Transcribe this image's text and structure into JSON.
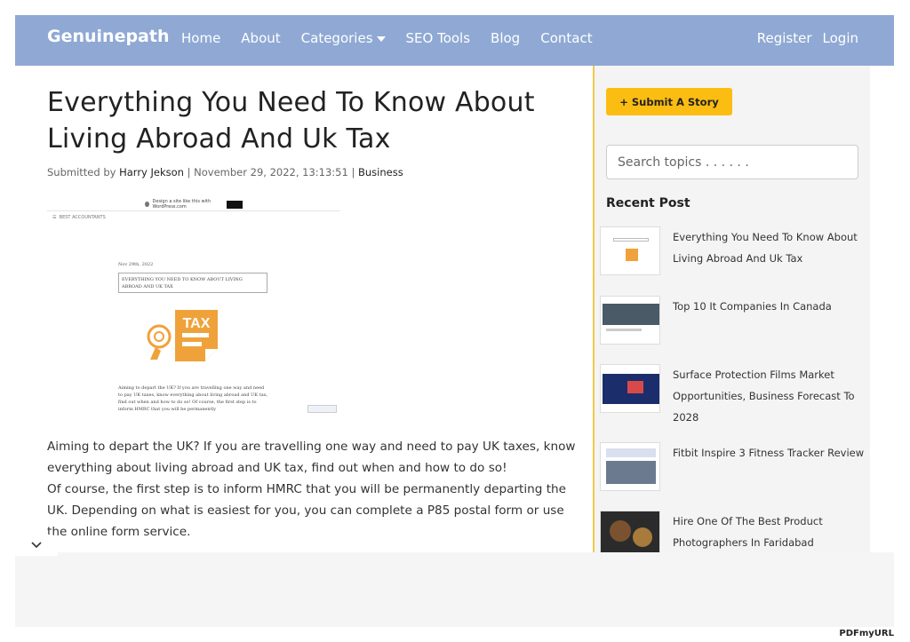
{
  "nav": {
    "brand": "Genuinepath",
    "links": [
      "Home",
      "About",
      "Categories",
      "SEO Tools",
      "Blog",
      "Contact"
    ],
    "register": "Register",
    "login": "Login"
  },
  "article": {
    "title": "Everything You Need To Know About Living Abroad And Uk Tax",
    "submitted_by_prefix": "Submitted by",
    "author": "Harry Jekson",
    "date": "November 29, 2022, 13:13:51",
    "category": "Business",
    "image": {
      "top_bar_text": "Design a site like this with WordPress.com",
      "menu_label": "BEST ACCOUNTANTS",
      "post_date": "Nov 29th, 2022",
      "post_title": "EVERYTHING YOU NEED TO KNOW ABOUT LIVING ABROAD AND UK TAX",
      "icon_label": "TAX",
      "excerpt": "Aiming to depart the UK? If you are travelling one way and need to pay UK taxes, know everything about living abroad and UK tax, find out when and how to do so! Of course, the first step is to inform HMRC that you will be permanently"
    },
    "paragraphs": [
      "Aiming to depart the UK? If you are travelling one way and need to pay UK taxes, know everything about living abroad and UK tax, find out when and how to do so!",
      "Of course, the first step is to inform HMRC that you will be permanently departing the UK. Depending on what is easiest for you, you can complete a P85 postal form or use the online form service."
    ]
  },
  "sidebar": {
    "submit_label": "+ Submit A Story",
    "search_placeholder": "Search topics . . . . . .",
    "recent_title": "Recent Post",
    "recent": [
      "Everything You Need To Know About Living Abroad And Uk Tax",
      "Top 10 It Companies In Canada",
      "Surface Protection Films Market Opportunities, Business Forecast To 2028",
      "Fitbit Inspire 3 Fitness Tracker Review",
      "Hire One Of The Best Product Photographers In Faridabad"
    ]
  },
  "footer": {
    "pdf_mark": "PDFmyURL"
  },
  "colors": {
    "navbar": "#8fa9d4",
    "accent": "#fcbd12",
    "divider": "#f2c94c",
    "tax_orange": "#f0a23a"
  }
}
